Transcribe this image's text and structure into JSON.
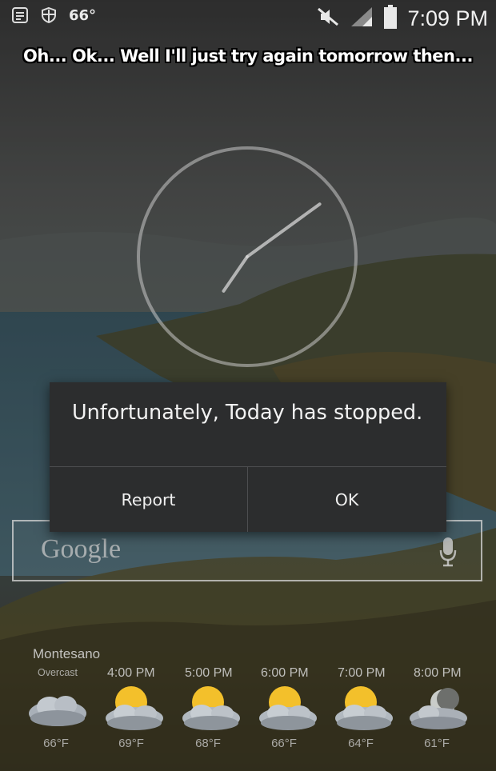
{
  "statusbar": {
    "temperature": "66°",
    "time": "7:09 PM",
    "icons": [
      "notes-icon",
      "shield-icon",
      "mute-icon",
      "signal-icon",
      "battery-icon"
    ]
  },
  "caption": "Oh... Ok... Well I'll just try again tomorrow then...",
  "clock": {
    "hours": 7,
    "minutes": 9
  },
  "dialog": {
    "message": "Unfortunately, Today has stopped.",
    "report_label": "Report",
    "ok_label": "OK"
  },
  "search": {
    "logo_text": "Google"
  },
  "weather": {
    "location": "Montesano",
    "condition": "Overcast",
    "forecast": [
      {
        "time": "",
        "temp": "66°F",
        "icon": "cloudy-icon"
      },
      {
        "time": "4:00 PM",
        "temp": "69°F",
        "icon": "partly-cloudy-icon"
      },
      {
        "time": "5:00 PM",
        "temp": "68°F",
        "icon": "partly-cloudy-icon"
      },
      {
        "time": "6:00 PM",
        "temp": "66°F",
        "icon": "partly-cloudy-icon"
      },
      {
        "time": "7:00 PM",
        "temp": "64°F",
        "icon": "partly-cloudy-icon"
      },
      {
        "time": "8:00 PM",
        "temp": "61°F",
        "icon": "night-cloudy-icon"
      }
    ]
  },
  "colors": {
    "dialog_bg": "#2c2d2e",
    "dialog_text": "#f2f2f2",
    "sun": "#f3c02b"
  }
}
